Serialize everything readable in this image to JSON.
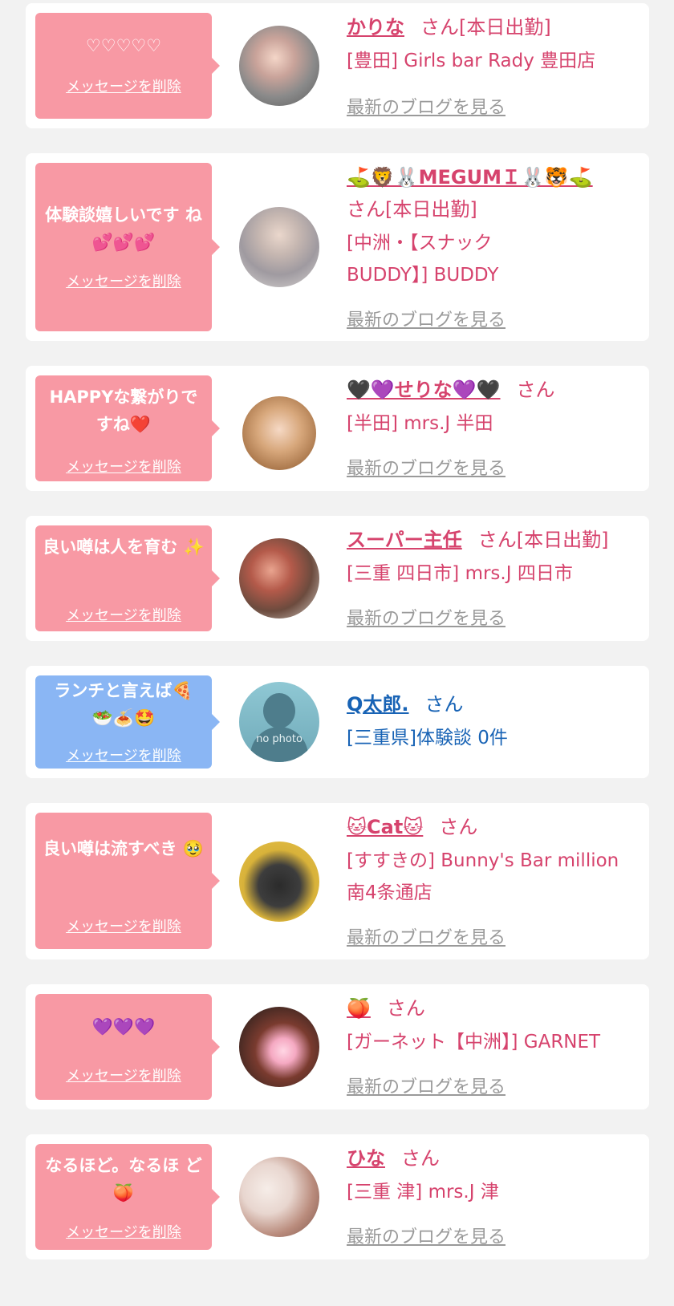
{
  "delete_label": "メッセージを削除",
  "blog_label": "最新のブログを見る",
  "cards": [
    {
      "message": "♡♡♡♡♡",
      "name": "かりな",
      "suffix": "さん[本日出勤]",
      "shop": "[豊田] Girls bar Rady 豊田店"
    },
    {
      "message": "体験談嬉しいです ね💕💕💕",
      "name": "⛳🦁🐰MEGUMＩ🐰🐯⛳",
      "suffix": "さん[本日出勤]",
      "shop": "[中洲・【スナック BUDDY】] BUDDY"
    },
    {
      "message": "HAPPYな繋がりで すね❤️",
      "name": "🖤💜せりな💜🖤",
      "suffix": "さん",
      "shop": "[半田] mrs.J 半田"
    },
    {
      "message": "良い噂は人を育む ✨",
      "name": "スーパー主任",
      "suffix": "さん[本日出勤]",
      "shop": "[三重 四日市] mrs.J 四日市"
    },
    {
      "message": "ランチと言えば🍕 🥗🍝🤩",
      "name": "Q太郎.",
      "suffix": "さん",
      "shop": "[三重県]体験談 0件",
      "avatar_text": "no photo"
    },
    {
      "message": "良い噂は流すべき 🥹",
      "name": "🐱Cat🐱",
      "suffix": "さん",
      "shop": "[すすきの] Bunny's Bar million 南4条通店"
    },
    {
      "message": "💜💜💜",
      "name": "🍑",
      "suffix": "さん",
      "shop": "[ガーネット【中洲】] GARNET"
    },
    {
      "message": "なるほど。なるほ ど🍑",
      "name": "ひな",
      "suffix": "さん",
      "shop": "[三重 津] mrs.J 津"
    }
  ]
}
